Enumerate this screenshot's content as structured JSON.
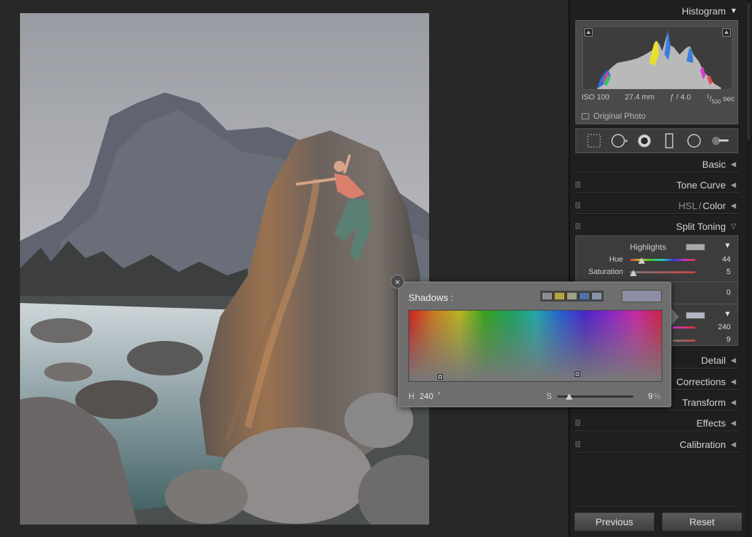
{
  "panel": {
    "histogram": {
      "title": "Histogram",
      "iso": "ISO 100",
      "focal": "27.4 mm",
      "aperture": "ƒ / 4.0",
      "shutter_num": "1",
      "shutter_den": "500",
      "shutter_unit": "sec",
      "original_photo": "Original Photo"
    },
    "sections": {
      "basic": "Basic",
      "tone_curve": "Tone Curve",
      "hsl": "HSL",
      "hsl_sep": "/",
      "color": "Color",
      "split_toning": "Split Toning",
      "detail": "Detail",
      "lens_corrections": "Corrections",
      "transform": "Transform",
      "effects": "Effects",
      "calibration": "Calibration"
    },
    "split_toning": {
      "highlights_label": "Highlights",
      "hue_label": "Hue",
      "hue_value": "44",
      "hue_fraction": 0.18,
      "saturation_label": "Saturation",
      "saturation_value": "5",
      "saturation_fraction": 0.05,
      "balance_value": "0",
      "shadows_hue_value": "240",
      "shadows_sat_value": "9"
    },
    "buttons": {
      "previous": "Previous",
      "reset": "Reset"
    }
  },
  "popup": {
    "title": "Shadows :",
    "swatch_colors": [
      "#8e8e8e",
      "#b4a43c",
      "#a39d84",
      "#4e73a6",
      "#8892aa"
    ],
    "current_color": "#8b8ea4",
    "h_label": "H",
    "h_value": "240",
    "h_unit": "°",
    "s_label": "S",
    "s_value": "9",
    "s_unit": "%",
    "s_fraction": 0.09
  },
  "colors": {
    "accent": "#6e6e6e",
    "panel_bg": "#1f1f1f"
  }
}
